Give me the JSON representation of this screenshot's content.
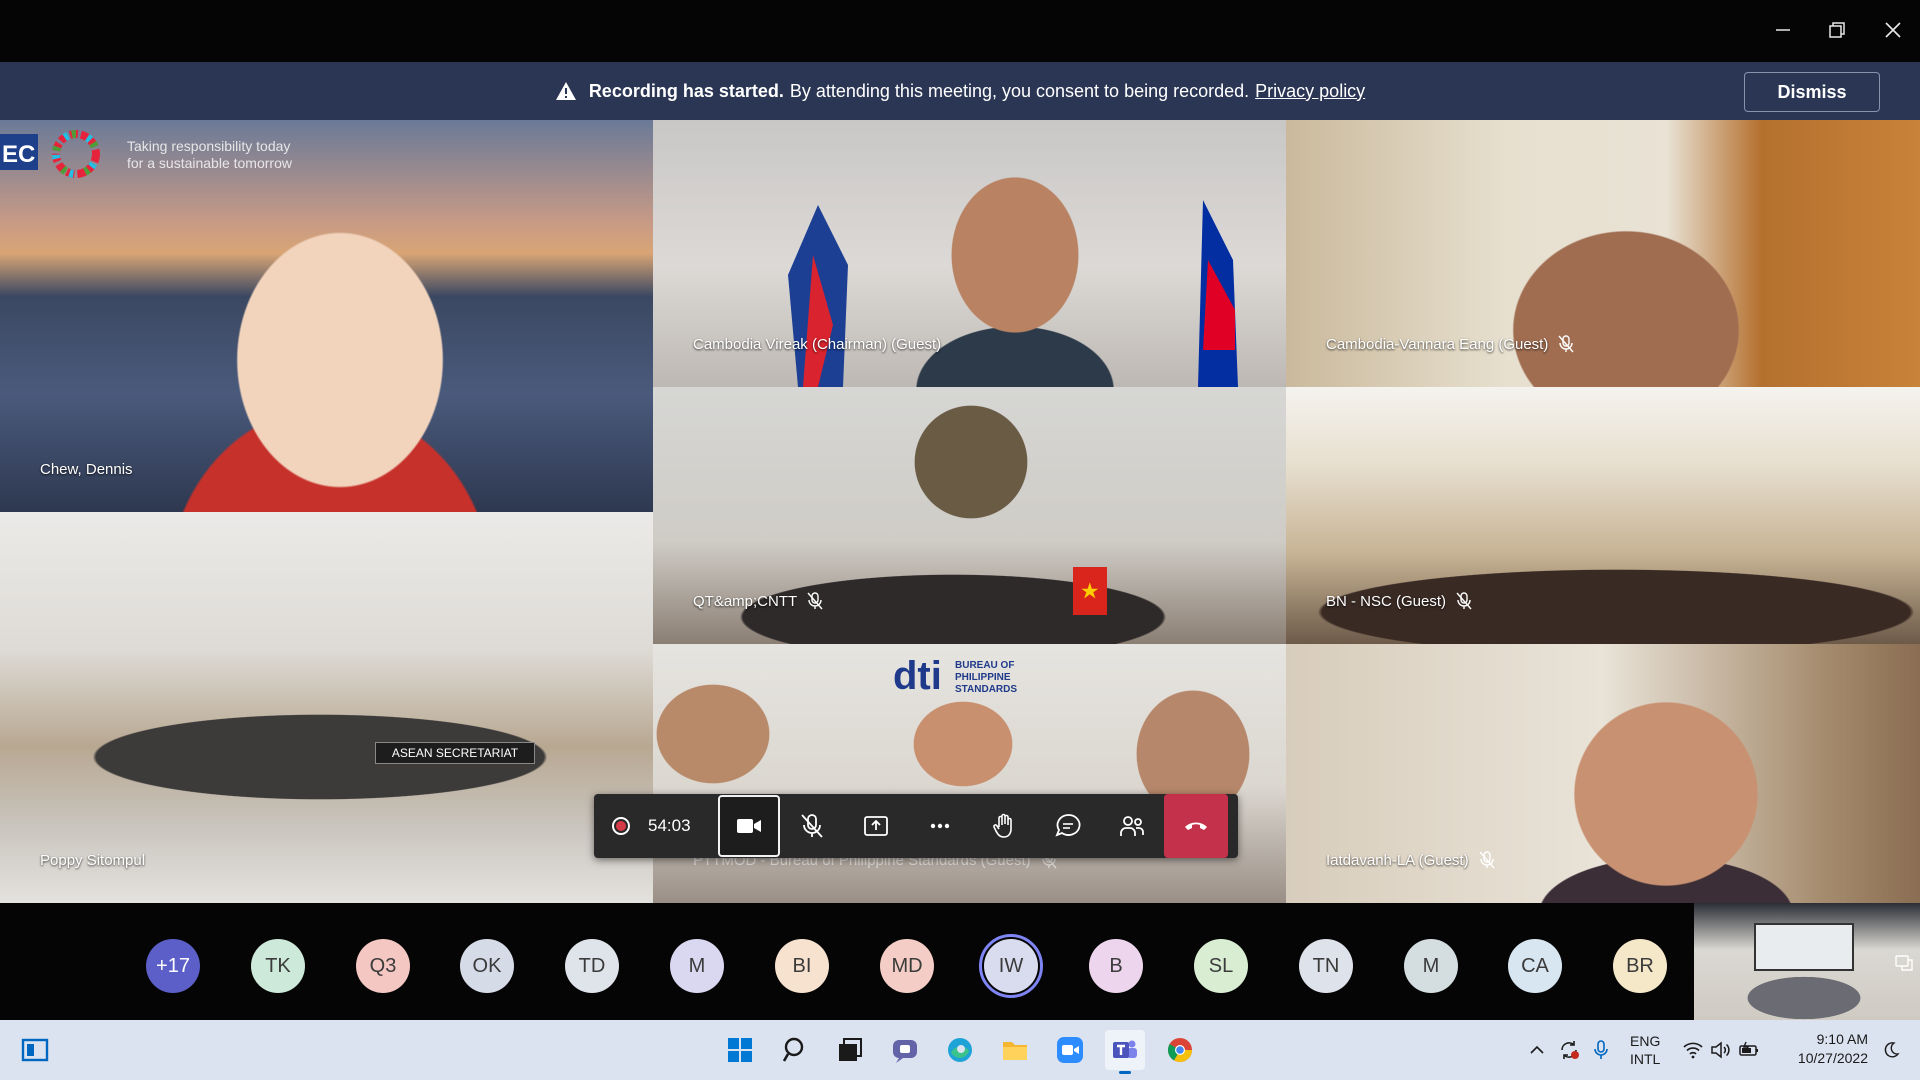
{
  "window": {
    "minimize_label": "Minimize",
    "maximize_label": "Restore",
    "close_label": "Close"
  },
  "banner": {
    "bold": "Recording has started.",
    "text": "By attending this meeting, you consent to being recorded.",
    "link": "Privacy policy",
    "dismiss": "Dismiss"
  },
  "tiles": {
    "chew": {
      "name": "Chew, Dennis",
      "overlay_line1": "Taking responsibility today",
      "overlay_line2": "for a sustainable tomorrow",
      "logo_text": "EC"
    },
    "vireak": {
      "name": "Cambodia Vireak (Chairman) (Guest)"
    },
    "vannara": {
      "name": "Cambodia-Vannara Eang (Guest)"
    },
    "qt": {
      "name": "QT&amp;CNTT"
    },
    "bn": {
      "name": "BN - NSC (Guest)"
    },
    "poppy": {
      "name": "Poppy Sitompul",
      "sign": "ASEAN SECRETARIAT"
    },
    "pitmod": {
      "name": "PTTMOD - Bureau of Philippine Standards (Guest)",
      "sign_brand": "dti",
      "sign_text": "BUREAU OF PHILIPPINE STANDARDS"
    },
    "iatdavanh": {
      "name": "Iatdavanh-LA (Guest)"
    }
  },
  "controls": {
    "timer": "54:03"
  },
  "participants": [
    {
      "initials": "+17",
      "color": "#5b5fc7"
    },
    {
      "initials": "TK",
      "color": "#cde9d9"
    },
    {
      "initials": "Q3",
      "color": "#f4c7c3"
    },
    {
      "initials": "OK",
      "color": "#d6dbe8"
    },
    {
      "initials": "TD",
      "color": "#dfe3ea"
    },
    {
      "initials": "M",
      "color": "#dad7f1"
    },
    {
      "initials": "BI",
      "color": "#f6e2cf"
    },
    {
      "initials": "MD",
      "color": "#f4cdc6"
    },
    {
      "initials": "IW",
      "color": "#d9dcef"
    },
    {
      "initials": "B",
      "color": "#eed5ee"
    },
    {
      "initials": "SL",
      "color": "#d9edd3"
    },
    {
      "initials": "TN",
      "color": "#dee2ea"
    },
    {
      "initials": "M",
      "color": "#d4dde0"
    },
    {
      "initials": "CA",
      "color": "#d8e6f2"
    },
    {
      "initials": "BR",
      "color": "#f5e8c9"
    }
  ],
  "taskbar": {
    "lang_line1": "ENG",
    "lang_line2": "INTL",
    "time": "9:10 AM",
    "date": "10/27/2022"
  },
  "colors": {
    "banner_bg": "#2b3654",
    "leave_red": "#c4314b",
    "accent": "#5b5fc7"
  }
}
